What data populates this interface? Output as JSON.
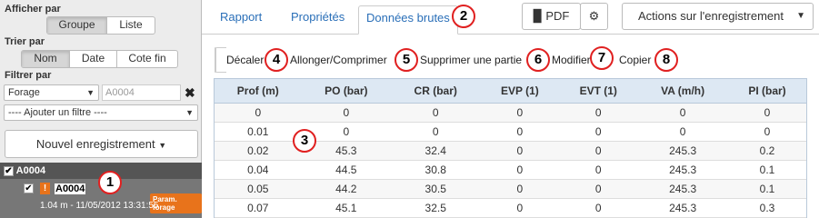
{
  "left_panel": {
    "display_label": "Afficher par",
    "display_options": [
      "Groupe",
      "Liste"
    ],
    "sort_label": "Trier par",
    "sort_options": [
      "Nom",
      "Date",
      "Cote fin"
    ],
    "filter_label": "Filtrer par",
    "filter_field": "Forage",
    "filter_value_placeholder": "A0004",
    "add_filter": "---- Ajouter un filtre ----",
    "new_record_button": "Nouvel enregistrement",
    "group_name": "A0004",
    "record_name": "A0004",
    "record_badge": "Param. forage",
    "record_detail": "1.04 m - 11/05/2012 13:31:55"
  },
  "tabs": [
    "Rapport",
    "Propriétés",
    "Données brutes"
  ],
  "header_buttons": {
    "pdf": "PDF",
    "settings_icon": "gear-icon",
    "actions": "Actions sur l'enregistrement"
  },
  "toolbar": [
    "Décaler",
    "Allonger/Comprimer",
    "Supprimer une partie",
    "Modifier",
    "Copier"
  ],
  "table": {
    "headers": [
      "Prof (m)",
      "PO (bar)",
      "CR (bar)",
      "EVP (1)",
      "EVT (1)",
      "VA (m/h)",
      "PI (bar)"
    ],
    "rows": [
      [
        "0",
        "0",
        "0",
        "0",
        "0",
        "0",
        "0"
      ],
      [
        "0.01",
        "0",
        "0",
        "0",
        "0",
        "0",
        "0"
      ],
      [
        "0.02",
        "45.3",
        "32.4",
        "0",
        "0",
        "245.3",
        "0.2"
      ],
      [
        "0.04",
        "44.5",
        "30.8",
        "0",
        "0",
        "245.3",
        "0.1"
      ],
      [
        "0.05",
        "44.2",
        "30.5",
        "0",
        "0",
        "245.3",
        "0.1"
      ],
      [
        "0.07",
        "45.1",
        "32.5",
        "0",
        "0",
        "245.3",
        "0.3"
      ]
    ]
  },
  "callouts": [
    "1",
    "2",
    "3",
    "4",
    "5",
    "6",
    "7",
    "8"
  ],
  "colors": {
    "accent": "#2a6fb8",
    "callout": "#e02020",
    "badge": "#e8731b",
    "table_header": "#dde8f3"
  }
}
